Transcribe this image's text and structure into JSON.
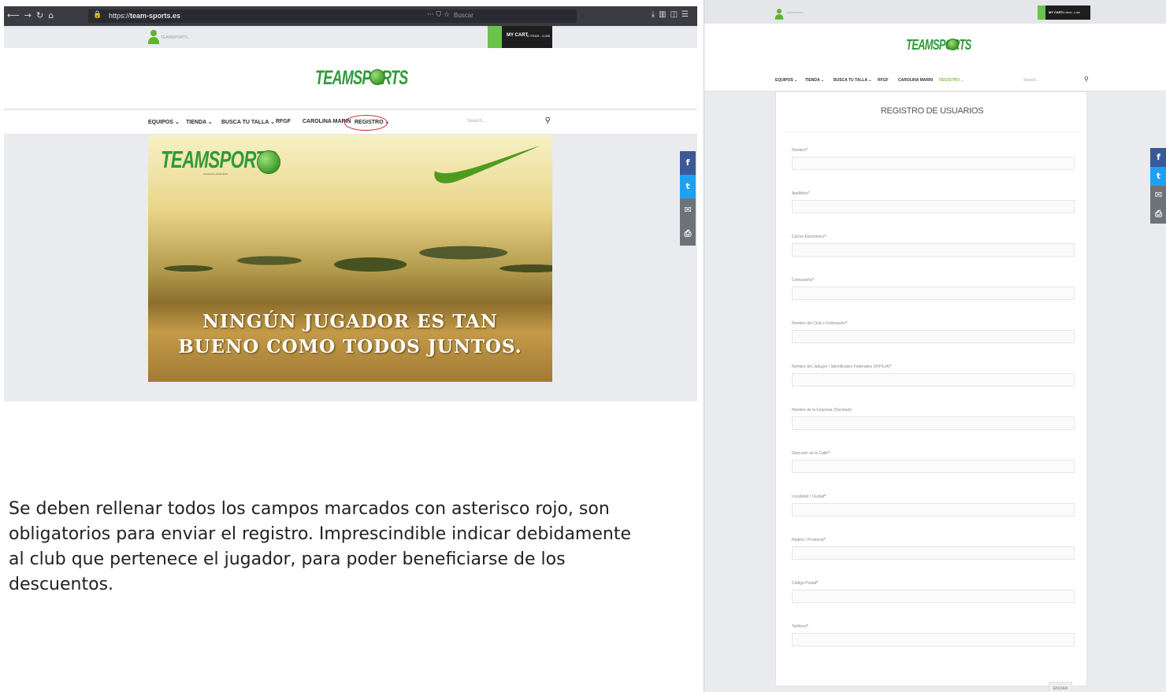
{
  "left_screenshot": {
    "browser": {
      "url_prefix": "https://",
      "url_domain": "team-sports.es",
      "search_placeholder": "Buscar"
    },
    "top_strip": {
      "account_text": "TEAMSPORTS",
      "cart_label": "MY CART",
      "cart_detail": "0 ITEMS - 0,00€"
    },
    "logo": {
      "brand": "TEAMSPORTS"
    },
    "nav": {
      "items": [
        "EQUIPOS",
        "TIENDA",
        "BUSCA TU TALLA",
        "RFGF",
        "CAROLINA MARIN",
        "REGISTRO"
      ],
      "search_placeholder": "Search..."
    },
    "hero": {
      "brand": "TEAMSPORTS",
      "brand_sub": "distribuidor oficial NIKE",
      "line1": "NINGÚN JUGADOR ES TAN",
      "line2": "BUENO COMO TODOS JUNTOS."
    },
    "social": [
      {
        "icon": "facebook-icon",
        "glyph": "f",
        "color": "#3b5998"
      },
      {
        "icon": "twitter-icon",
        "glyph": "t",
        "color": "#1da1f2"
      },
      {
        "icon": "email-icon",
        "glyph": "✉",
        "color": "#6d7378"
      },
      {
        "icon": "print-icon",
        "glyph": "⎙",
        "color": "#6d7378"
      }
    ]
  },
  "caption": {
    "text": "Se deben rellenar todos los campos marcados con asterisco rojo, son obligatorios para enviar el registro.  Imprescindible indicar debidamente al club que pertenece el jugador, para poder beneficiarse de los descuentos."
  },
  "right_screenshot": {
    "top_strip": {
      "account_text": "TEAMSPORTS",
      "cart_label": "MY CART",
      "cart_detail": "0 ITEMS - 0,00€"
    },
    "logo": {
      "brand": "TEAMSPORTS"
    },
    "nav": {
      "items": [
        "EQUIPOS",
        "TIENDA",
        "BUSCA TU TALLA",
        "RFGF",
        "CAROLINA MARIN",
        "REGISTRO"
      ],
      "search_placeholder": "Search..."
    },
    "form": {
      "title": "REGISTRO DE USUARIOS",
      "fields": [
        {
          "label": "Nombre",
          "required": "*"
        },
        {
          "label": "Apellidos",
          "required": "*"
        },
        {
          "label": "Correo Electrónico",
          "required": "*"
        },
        {
          "label": "Contraseña",
          "required": "*"
        },
        {
          "label": "Nombre del Club o Federación",
          "required": "*"
        },
        {
          "label": "Nombre del Jadugor / Identificativo Federativo (NºFILIA)",
          "required": "*"
        },
        {
          "label": "Nombre de la Empresa (Opcional)",
          "required": ""
        },
        {
          "label": "Dirección de la Calle",
          "required": "*"
        },
        {
          "label": "Localidad / Ciudad",
          "required": "*"
        },
        {
          "label": "Región / Provincia",
          "required": "*"
        },
        {
          "label": "Código Postal",
          "required": "*"
        },
        {
          "label": "Teléfono",
          "required": "*"
        }
      ],
      "submit_label": "ENVIAR"
    },
    "social": [
      {
        "icon": "facebook-icon",
        "glyph": "f",
        "color": "#3b5998"
      },
      {
        "icon": "twitter-icon",
        "glyph": "t",
        "color": "#1da1f2"
      },
      {
        "icon": "email-icon",
        "glyph": "✉",
        "color": "#6d7378"
      },
      {
        "icon": "print-icon",
        "glyph": "⎙",
        "color": "#6d7378"
      }
    ]
  },
  "colors": {
    "brand_green": "#2f9b3a",
    "cart_green": "#6cc24a",
    "highlight_red": "#d2202f"
  }
}
